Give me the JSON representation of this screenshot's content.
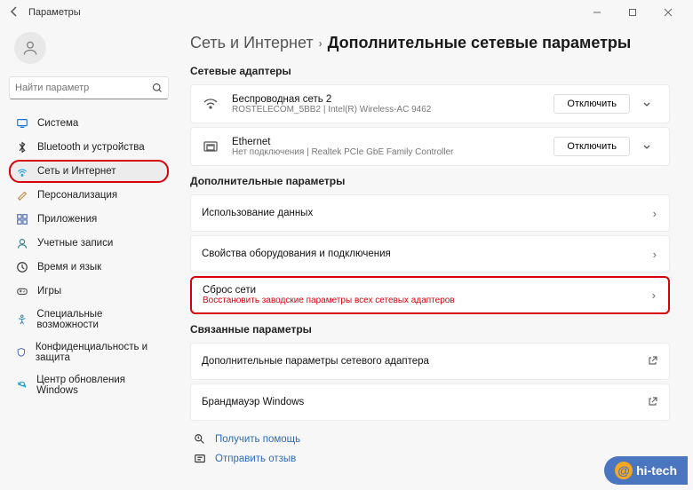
{
  "window": {
    "title": "Параметры"
  },
  "sidebar": {
    "search_placeholder": "Найти параметр",
    "items": [
      {
        "label": "Система",
        "icon": "system",
        "color": "#1976d2"
      },
      {
        "label": "Bluetooth и устройства",
        "icon": "bluetooth",
        "color": "#333"
      },
      {
        "label": "Сеть и Интернет",
        "icon": "network",
        "color": "#1fa0d8",
        "selected": true,
        "highlight": true
      },
      {
        "label": "Персонализация",
        "icon": "personalization",
        "color": "#c08a3e"
      },
      {
        "label": "Приложения",
        "icon": "apps",
        "color": "#4a66b0"
      },
      {
        "label": "Учетные записи",
        "icon": "accounts",
        "color": "#38808a"
      },
      {
        "label": "Время и язык",
        "icon": "time",
        "color": "#333"
      },
      {
        "label": "Игры",
        "icon": "gaming",
        "color": "#555"
      },
      {
        "label": "Специальные возможности",
        "icon": "accessibility",
        "color": "#3a88c0"
      },
      {
        "label": "Конфиденциальность и защита",
        "icon": "privacy",
        "color": "#4a66b0"
      },
      {
        "label": "Центр обновления Windows",
        "icon": "update",
        "color": "#1fa0d8"
      }
    ]
  },
  "breadcrumb": {
    "parent": "Сеть и Интернет",
    "current": "Дополнительные сетевые параметры"
  },
  "sections": {
    "adapters_title": "Сетевые адаптеры",
    "advanced_title": "Дополнительные параметры",
    "related_title": "Связанные параметры"
  },
  "adapters": [
    {
      "title": "Беспроводная сеть 2",
      "sub": "ROSTELECOM_5BB2 | Intel(R) Wireless-AC 9462",
      "action": "Отключить",
      "icon": "wifi"
    },
    {
      "title": "Ethernet",
      "sub": "Нет подключения | Realtek PCIe GbE Family Controller",
      "action": "Отключить",
      "icon": "ethernet"
    }
  ],
  "advanced": [
    {
      "title": "Использование данных"
    },
    {
      "title": "Свойства оборудования и подключения"
    },
    {
      "title": "Сброс сети",
      "sub": "Восстановить заводские параметры всех сетевых адаптеров",
      "highlight": true
    }
  ],
  "related": [
    {
      "title": "Дополнительные параметры сетевого адаптера"
    },
    {
      "title": "Брандмауэр Windows"
    }
  ],
  "footer": {
    "help": "Получить помощь",
    "feedback": "Отправить отзыв"
  },
  "watermark": "hi-tech"
}
